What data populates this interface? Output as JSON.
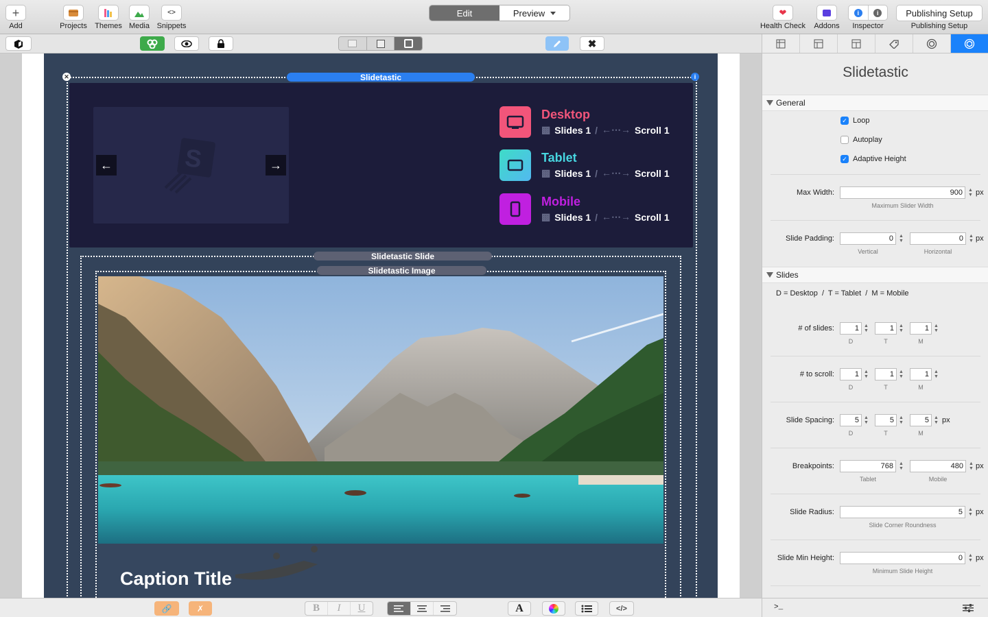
{
  "toolbar": {
    "add": "Add",
    "projects": "Projects",
    "themes": "Themes",
    "media": "Media",
    "snippets": "Snippets",
    "edit": "Edit",
    "preview": "Preview",
    "health_check": "Health Check",
    "addons": "Addons",
    "inspector": "Inspector",
    "publishing_setup_button": "Publishing Setup",
    "publishing_setup_label": "Publishing Setup"
  },
  "canvas": {
    "slider_tag": "Slidetastic",
    "slide_tag": "Slidetastic Slide",
    "image_tag": "Slidetastic Image",
    "caption": "Caption Title",
    "devices": [
      {
        "name": "Desktop",
        "slides": "Slides 1",
        "scroll": "Scroll 1",
        "color": "#f2557a"
      },
      {
        "name": "Tablet",
        "slides": "Slides 1",
        "scroll": "Scroll 1",
        "color": "#47d6e0"
      },
      {
        "name": "Mobile",
        "slides": "Slides 1",
        "scroll": "Scroll 1",
        "color": "#c020e0"
      }
    ]
  },
  "panel": {
    "title": "Slidetastic",
    "general": {
      "heading": "General",
      "loop": {
        "label": "Loop",
        "checked": true
      },
      "autoplay": {
        "label": "Autoplay",
        "checked": false
      },
      "adaptive_height": {
        "label": "Adaptive Height",
        "checked": true
      }
    },
    "max_width": {
      "label": "Max Width:",
      "value": "900",
      "unit": "px",
      "hint": "Maximum Slider Width"
    },
    "slide_padding": {
      "label": "Slide Padding:",
      "vertical": "0",
      "horizontal": "0",
      "unit": "px",
      "hint_v": "Vertical",
      "hint_h": "Horizontal"
    },
    "slides": {
      "heading": "Slides",
      "legend": "D = Desktop  /  T = Tablet  /  M = Mobile",
      "num_slides": {
        "label": "# of slides:",
        "d": "1",
        "t": "1",
        "m": "1"
      },
      "to_scroll": {
        "label": "# to scroll:",
        "d": "1",
        "t": "1",
        "m": "1"
      },
      "spacing": {
        "label": "Slide Spacing:",
        "d": "5",
        "t": "5",
        "m": "5",
        "unit": "px"
      },
      "d": "D",
      "t": "T",
      "m": "M"
    },
    "breakpoints": {
      "label": "Breakpoints:",
      "tablet": "768",
      "mobile": "480",
      "unit": "px",
      "hint_t": "Tablet",
      "hint_m": "Mobile"
    },
    "radius": {
      "label": "Slide Radius:",
      "value": "5",
      "unit": "px",
      "hint": "Slide Corner Roundness"
    },
    "min_height": {
      "label": "Slide Min Height:",
      "value": "0",
      "unit": "px",
      "hint": "Minimum Slide Height"
    },
    "console_prompt": ">_"
  },
  "colors": {
    "accent": "#1a82fb",
    "toolbar_orange": "#f6b47a",
    "slider_bg": "#1c1c3a"
  }
}
